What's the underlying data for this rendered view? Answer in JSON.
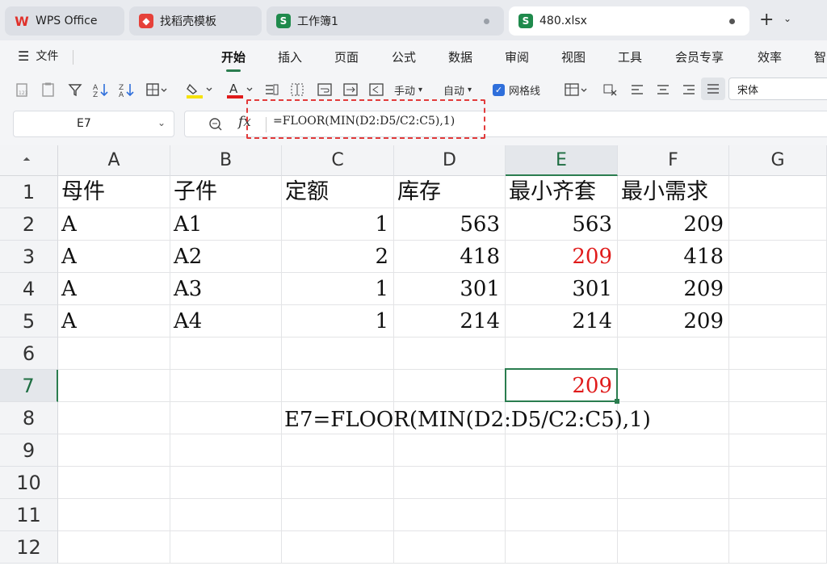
{
  "tabs": [
    {
      "label": "WPS Office",
      "icon": "wps-logo-icon"
    },
    {
      "label": "找稻壳模板",
      "icon": "docer-icon"
    },
    {
      "label": "工作簿1",
      "icon": "sheet-icon"
    },
    {
      "label": "480.xlsx",
      "icon": "sheet-icon"
    }
  ],
  "menu": {
    "file": "文件",
    "items": [
      "开始",
      "插入",
      "页面",
      "公式",
      "数据",
      "审阅",
      "视图",
      "工具",
      "会员专享",
      "效率",
      "智"
    ],
    "active": "开始"
  },
  "toolbar": {
    "manual": "手动",
    "auto": "自动",
    "gridlines": "网格线",
    "font": "宋体"
  },
  "formula_bar": {
    "cell_ref": "E7",
    "formula": "=FLOOR(MIN(D2:D5/C2:C5),1)"
  },
  "columns": [
    "A",
    "B",
    "C",
    "D",
    "E",
    "F",
    "G"
  ],
  "rows": [
    "1",
    "2",
    "3",
    "4",
    "5",
    "6",
    "7",
    "8",
    "9",
    "10",
    "11",
    "12"
  ],
  "table": {
    "headers": [
      "母件",
      "子件",
      "定额",
      "库存",
      "最小齐套",
      "最小需求"
    ],
    "rows": [
      [
        "A",
        "A1",
        "1",
        "563",
        "563",
        "209"
      ],
      [
        "A",
        "A2",
        "2",
        "418",
        "209",
        "418"
      ],
      [
        "A",
        "A3",
        "1",
        "301",
        "301",
        "209"
      ],
      [
        "A",
        "A4",
        "1",
        "214",
        "214",
        "209"
      ]
    ]
  },
  "result_cell_value": "209",
  "note_text": "E7=FLOOR(MIN(D2:D5/C2:C5),1)",
  "colors": {
    "accent": "#2a7d4f",
    "highlight": "#e01b1b",
    "annotation": "#e23b3b"
  }
}
